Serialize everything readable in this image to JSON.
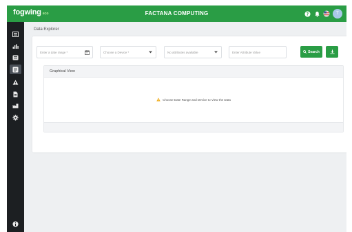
{
  "header": {
    "logo_text": "fogwing",
    "logo_suffix": "eco",
    "app_title": "FACTANA COMPUTING",
    "avatar_initial": "T",
    "icons": [
      "help-icon",
      "bell-icon",
      "flag-icon"
    ],
    "brand_color": "#2a9d45"
  },
  "sidebar": {
    "items": [
      {
        "icon": "dashboard-icon"
      },
      {
        "icon": "chart-icon"
      },
      {
        "icon": "list-icon"
      },
      {
        "icon": "data-explorer-icon",
        "active": true
      },
      {
        "icon": "alert-icon"
      },
      {
        "icon": "document-icon"
      },
      {
        "icon": "factory-icon"
      },
      {
        "icon": "settings-icon"
      }
    ],
    "bottom_icon": "info-icon"
  },
  "page": {
    "title": "Data Explorer"
  },
  "filters": {
    "date_range_placeholder": "Enter a date range *",
    "device_placeholder": "Choose a Device *",
    "attributes_placeholder": "No attributes available",
    "attribute_value_placeholder": "Enter Attribute Value",
    "search_label": "Search"
  },
  "graph": {
    "title": "Graphical View",
    "empty_message": "Choose Date Range and Device to View the Data"
  }
}
